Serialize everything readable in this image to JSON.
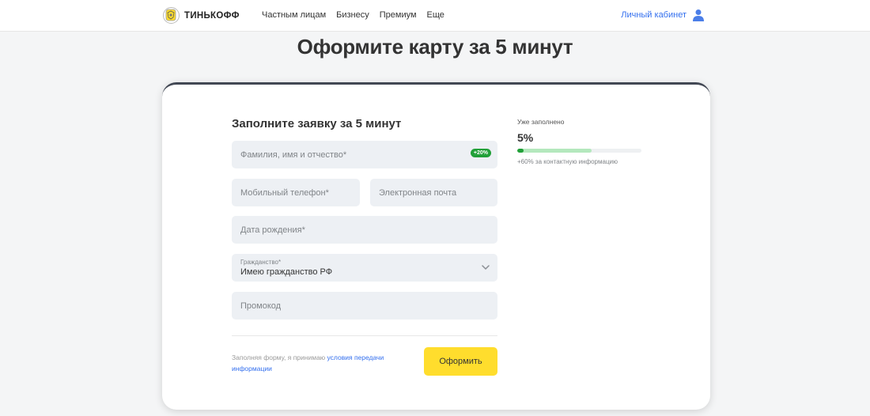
{
  "header": {
    "logo_text": "ТИНЬКОФФ",
    "nav": [
      "Частным лицам",
      "Бизнесу",
      "Премиум",
      "Еще"
    ],
    "cabinet_label": "Личный кабинет"
  },
  "page_title": "Оформите карту за 5 минут",
  "form": {
    "title": "Заполните заявку за 5 минут",
    "full_name_placeholder": "Фамилия, имя и отчество*",
    "full_name_badge": "+20%",
    "phone_placeholder": "Мобильный телефон*",
    "email_placeholder": "Электронная почта",
    "birth_placeholder": "Дата рождения*",
    "citizenship_label": "Гражданство*",
    "citizenship_value": "Имею гражданство РФ",
    "promo_placeholder": "Промокод",
    "consent_text": "Заполняя форму, я принимаю ",
    "consent_link": "условия передачи информации",
    "submit_label": "Оформить"
  },
  "progress": {
    "label": "Уже заполнено",
    "percent_text": "5%",
    "percent_value": 5,
    "projected_value": 60,
    "hint": "+60% за контактную информацию"
  },
  "colors": {
    "accent_yellow": "#ffdd2d",
    "link_blue": "#336fee",
    "success_green": "#21a038",
    "field_bg": "#edf0f4"
  }
}
